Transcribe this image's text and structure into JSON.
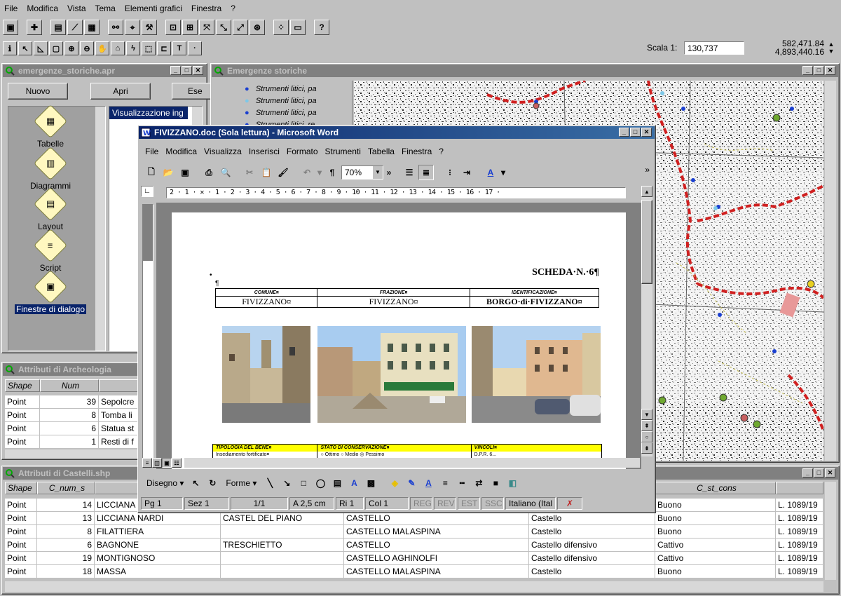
{
  "menu": [
    "File",
    "Modifica",
    "Vista",
    "Tema",
    "Elementi grafici",
    "Finestra",
    "?"
  ],
  "scale": {
    "label": "Scala 1:",
    "value": "130,737",
    "coord_x": "582,471.84",
    "coord_y": "4,893,440.16"
  },
  "project_window": {
    "title": "emergenze_storiche.apr",
    "buttons": [
      "Nuovo",
      "Apri",
      "Ese"
    ],
    "items": [
      {
        "label": "Tabelle",
        "icon": "table-icon"
      },
      {
        "label": "Diagrammi",
        "icon": "chart-icon"
      },
      {
        "label": "Layout",
        "icon": "layout-icon"
      },
      {
        "label": "Script",
        "icon": "script-icon"
      },
      {
        "label": "Finestre di dialogo",
        "icon": "dialog-icon"
      }
    ],
    "list_header": "Visualizzazione ing"
  },
  "map_window": {
    "title": "Emergenze storiche",
    "legend": [
      {
        "label": "Strumenti litici, pa",
        "color": "#1a3fd0"
      },
      {
        "label": "Strumenti litici, pa",
        "color": "#7ec8e8"
      },
      {
        "label": "Strumenti litici, pa",
        "color": "#1a3fd0"
      },
      {
        "label": "Strumenti litici, re",
        "color": "#1a3fd0"
      }
    ]
  },
  "arch_table": {
    "title": "Attributi di Archeologia",
    "headers": [
      "Shape",
      "Num"
    ],
    "rows": [
      {
        "shape": "Point",
        "num": "39",
        "desc": "Sepolcre"
      },
      {
        "shape": "Point",
        "num": "8",
        "desc": "Tomba li"
      },
      {
        "shape": "Point",
        "num": "6",
        "desc": "Statua st"
      },
      {
        "shape": "Point",
        "num": "1",
        "desc": "Resti di f"
      }
    ]
  },
  "castelli_table": {
    "title": "Attributi di Castelli.shp",
    "headers": [
      "Shape",
      "C_num_s",
      "",
      "",
      "",
      "C_st_cons",
      ""
    ],
    "rows": [
      {
        "shape": "Point",
        "num": "14",
        "comune": "LICCIANA",
        "frazione": "",
        "nome": "",
        "tipo": "",
        "stato": "Buono",
        "legge": "L. 1089/19"
      },
      {
        "shape": "Point",
        "num": "13",
        "comune": "LICCIANA NARDI",
        "frazione": "CASTEL DEL PIANO",
        "nome": "CASTELLO",
        "tipo": "Castello",
        "stato": "Buono",
        "legge": "L. 1089/19"
      },
      {
        "shape": "Point",
        "num": "8",
        "comune": "FILATTIERA",
        "frazione": "",
        "nome": "CASTELLO MALASPINA",
        "tipo": "Castello",
        "stato": "Buono",
        "legge": "L. 1089/19"
      },
      {
        "shape": "Point",
        "num": "6",
        "comune": "BAGNONE",
        "frazione": "TRESCHIETTO",
        "nome": "CASTELLO",
        "tipo": "Castello difensivo",
        "stato": "Cattivo",
        "legge": "L. 1089/19"
      },
      {
        "shape": "Point",
        "num": "19",
        "comune": "MONTIGNOSO",
        "frazione": "",
        "nome": "CASTELLO AGHINOLFI",
        "tipo": "Castello difensivo",
        "stato": "Cattivo",
        "legge": "L. 1089/19"
      },
      {
        "shape": "Point",
        "num": "18",
        "comune": "MASSA",
        "frazione": "",
        "nome": "CASTELLO MALASPINA",
        "tipo": "Castello",
        "stato": "Buono",
        "legge": "L. 1089/19"
      }
    ]
  },
  "word": {
    "title": "FIVIZZANO.doc (Sola lettura) - Microsoft Word",
    "menu": [
      "File",
      "Modifica",
      "Visualizza",
      "Inserisci",
      "Formato",
      "Strumenti",
      "Tabella",
      "Finestra",
      "?"
    ],
    "zoom": "70%",
    "ruler": "2 · 1 · ✕ · 1 · 2 · 3 · 4 · 5 · 6 · 7 · 8 · 9 · 10 · 11 · 12 · 13 · 14 · 15 · 16 · 17 ·",
    "doc": {
      "scheda": "SCHEDA·N.·6¶",
      "headers": [
        "COMUNE¤",
        "FRAZIONE¤",
        "IDENTIFICAZIONE¤"
      ],
      "values": [
        "FIVIZZANO¤",
        "FIVIZZANO¤",
        "BORGO·di·FIVIZZANO¤"
      ],
      "bottom_headers": [
        "TIPOLOGIA DEL BENE¤",
        "STATO DI CONSERVAZIONE¤",
        "VINCOLI¤"
      ],
      "bottom_values": [
        "Insediamento fortificato¤",
        "○ Ottimo   ○ Medio   ◎ Pessimo",
        "D.P.R. 6..."
      ]
    },
    "drawing_bar": {
      "disegno": "Disegno ▾",
      "forme": "Forme ▾"
    },
    "status": {
      "page": "Pg  1",
      "section": "Sez  1",
      "pages": "1/1",
      "at": "A  2,5 cm",
      "line": "Ri  1",
      "col": "Col  1",
      "rec": "REG",
      "rev": "REV",
      "est": "EST",
      "ssc": "SSC",
      "lang": "Italiano (Ital"
    }
  },
  "colors": {
    "title_active": "#0a246a",
    "title_inactive": "#808080",
    "highlight": "#ffff00",
    "boundary": "#d02020"
  }
}
